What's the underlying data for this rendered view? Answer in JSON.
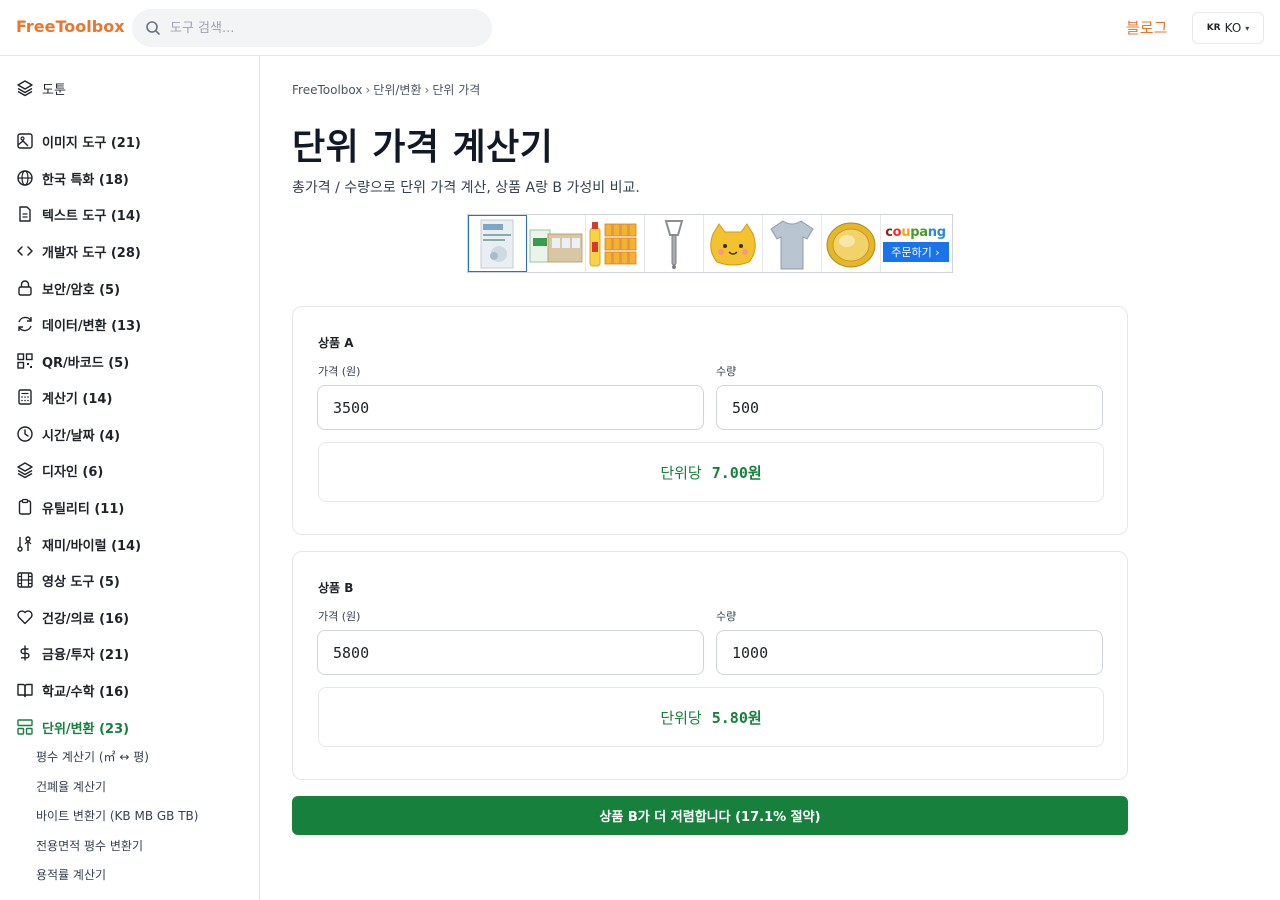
{
  "header": {
    "logo": "FreeToolbox",
    "search_placeholder": "도구 검색...",
    "blog_label": "블로그",
    "lang_flag": "KR",
    "lang_label": "KO"
  },
  "sidebar": {
    "top_item": "도툰",
    "categories": [
      {
        "label": "이미지 도구 (21)",
        "icon": "image-icon"
      },
      {
        "label": "한국 특화 (18)",
        "icon": "globe-icon"
      },
      {
        "label": "텍스트 도구 (14)",
        "icon": "document-icon"
      },
      {
        "label": "개발자 도구 (28)",
        "icon": "code-icon"
      },
      {
        "label": "보안/암호 (5)",
        "icon": "lock-icon"
      },
      {
        "label": "데이터/변환 (13)",
        "icon": "refresh-icon"
      },
      {
        "label": "QR/바코드 (5)",
        "icon": "qr-icon"
      },
      {
        "label": "계산기 (14)",
        "icon": "calculator-icon"
      },
      {
        "label": "시간/날짜 (4)",
        "icon": "clock-icon"
      },
      {
        "label": "디자인 (6)",
        "icon": "layers-icon"
      },
      {
        "label": "유틸리티 (11)",
        "icon": "clipboard-icon"
      },
      {
        "label": "재미/바이럴 (14)",
        "icon": "dice-icon"
      },
      {
        "label": "영상 도구 (5)",
        "icon": "film-icon"
      },
      {
        "label": "건강/의료 (16)",
        "icon": "heart-icon"
      },
      {
        "label": "금융/투자 (21)",
        "icon": "dollar-icon"
      },
      {
        "label": "학교/수학 (16)",
        "icon": "book-icon"
      },
      {
        "label": "단위/변환 (23)",
        "icon": "grid-icon"
      }
    ],
    "sub_items": [
      "평수 계산기 (㎡ ↔ 평)",
      "건폐율 계산기",
      "바이트 변환기 (KB MB GB TB)",
      "전용면적 평수 변환기",
      "용적률 계산기"
    ]
  },
  "breadcrumb": {
    "home": "FreeToolbox",
    "category": "단위/변환",
    "current": "단위 가격",
    "sep": "›"
  },
  "page": {
    "title": "단위 가격 계산기",
    "description": "총가격 / 수량으로 단위 가격 계산, 상품 A랑 B 가성비 비교."
  },
  "ad": {
    "logo_parts": [
      "c",
      "o",
      "u",
      "pa",
      "ng"
    ],
    "order_label": "주문하기 ›"
  },
  "product_a": {
    "title": "상품 A",
    "price_label": "가격 (원)",
    "price_value": "3500",
    "qty_label": "수량",
    "qty_value": "500",
    "unit_label": "단위당",
    "unit_value": "7.00원"
  },
  "product_b": {
    "title": "상품 B",
    "price_label": "가격 (원)",
    "price_value": "5800",
    "qty_label": "수량",
    "qty_value": "1000",
    "unit_label": "단위당",
    "unit_value": "5.80원"
  },
  "verdict": "상품 B가 더 저렴합니다 (17.1% 절약)",
  "colors": {
    "brand": "#e8762d",
    "success": "#17803d",
    "coupang_blue": "#1a73e8"
  }
}
